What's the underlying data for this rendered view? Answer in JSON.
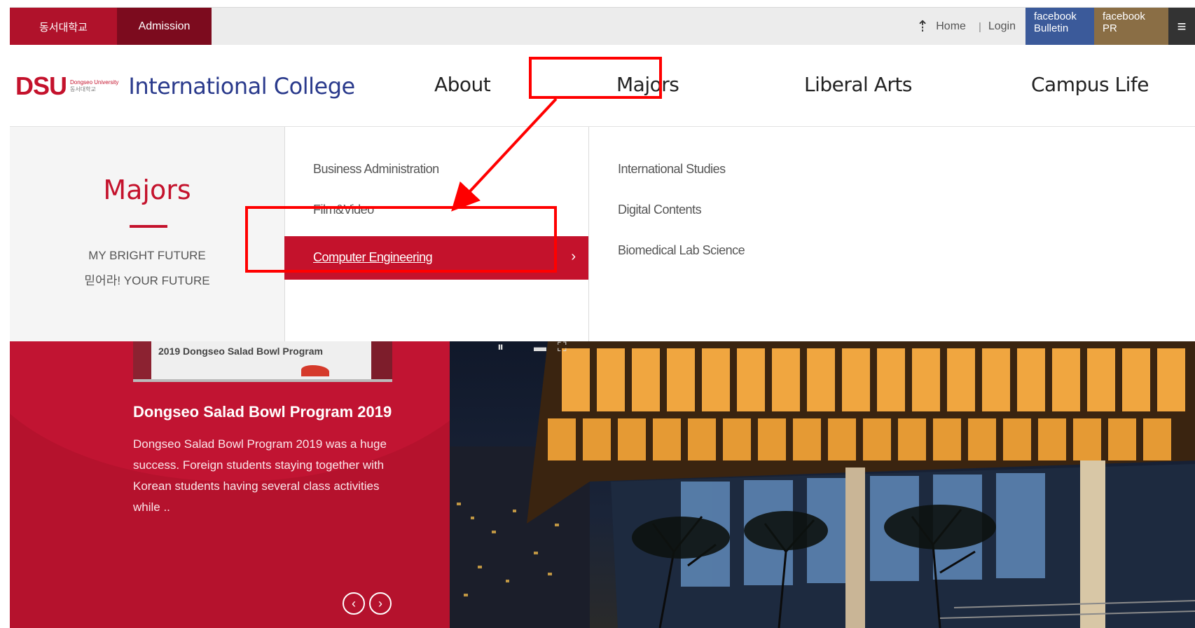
{
  "topbar": {
    "university_label": "동서대학교",
    "admission_label": "Admission",
    "home_label": "Home",
    "separator": "|",
    "login_label": "Login",
    "facebook_bulletin": [
      "facebook",
      "Bulletin"
    ],
    "facebook_pr": [
      "facebook",
      "PR"
    ]
  },
  "logo": {
    "dsu": "DSU",
    "small_en": "Dongseo University",
    "small_kr": "동서대학교",
    "college": "International College"
  },
  "nav": {
    "items": [
      "About",
      "Majors",
      "Liberal Arts",
      "Campus Life"
    ]
  },
  "dropdown": {
    "title": "Majors",
    "tagline1": "MY BRIGHT FUTURE",
    "tagline2": "믿어라! YOUR FUTURE",
    "col1": [
      "Business Administration",
      "Film&Video",
      "Computer Engineering"
    ],
    "active_index": 2,
    "col2": [
      "International Studies",
      "Digital Contents",
      "Biomedical Lab Science"
    ]
  },
  "news": {
    "thumb_caption": "2019 Dongseo Salad Bowl Program",
    "title": "Dongseo Salad Bowl Program 2019",
    "body": "Dongseo Salad Bowl Program 2019 was a huge success. Foreign students staying together with Korean students having several class activities while .."
  },
  "colors": {
    "brand_red": "#c4122c",
    "annotation": "#ff0000",
    "college_blue": "#2a3a8c"
  }
}
